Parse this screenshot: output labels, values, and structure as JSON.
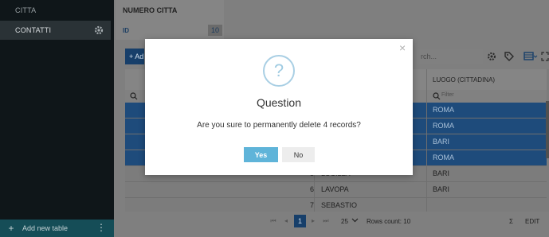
{
  "sidebar": {
    "items": [
      {
        "label": "CITTA"
      },
      {
        "label": "CONTATTI"
      }
    ],
    "footer_label": "Add new table",
    "gear_icon": "gear-icon",
    "more_icon": "vertical-ellipsis-icon"
  },
  "panel": {
    "title": "NUMERO CITTA",
    "id_label": "ID",
    "id_value": "10"
  },
  "toolbar": {
    "add_label": "+ Ad",
    "search_placeholder": "rch...",
    "icons": [
      "gear-icon",
      "tag-icon",
      "table-icon",
      "expand-icon"
    ]
  },
  "grid": {
    "column_header": "LUOGO (CITTADINA)",
    "filter_placeholder": "Filter",
    "rows": [
      {
        "id": "",
        "name": "",
        "luogo": "ROMA",
        "selected": true
      },
      {
        "id": "",
        "name": "",
        "luogo": "ROMA",
        "selected": true
      },
      {
        "id": "",
        "name": "",
        "luogo": "BARI",
        "selected": true
      },
      {
        "id": "",
        "name": "",
        "luogo": "ROMA",
        "selected": true
      },
      {
        "id": "5",
        "name": "LUCILLA",
        "luogo": "BARI",
        "selected": false
      },
      {
        "id": "6",
        "name": "LAVOPA",
        "luogo": "BARI",
        "selected": false
      },
      {
        "id": "7",
        "name": "SEBASTIO",
        "luogo": "",
        "selected": false
      }
    ]
  },
  "pager": {
    "current_page": "1",
    "page_size": "25",
    "rows_count": "Rows count: 10",
    "sigma": "Σ",
    "edit_label": "EDIT"
  },
  "modal": {
    "icon": "?",
    "title": "Question",
    "message": "Are you sure to permanently delete 4 records?",
    "yes_label": "Yes",
    "no_label": "No",
    "close": "×"
  },
  "colors": {
    "accent": "#5fb4d9",
    "selected_row": "#1e4b7b",
    "sidebar": "#0f1619",
    "sidebar_footer": "#154d57"
  }
}
